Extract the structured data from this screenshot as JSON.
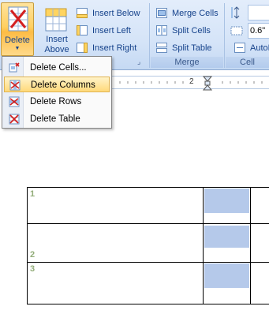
{
  "ribbon": {
    "delete_label": "Delete",
    "insert_above_label_line1": "Insert",
    "insert_above_label_line2": "Above",
    "insert_below_label": "Insert Below",
    "insert_left_label": "Insert Left",
    "insert_right_label": "Insert Right",
    "merge_cells_label": "Merge Cells",
    "split_cells_label": "Split Cells",
    "split_table_label": "Split Table",
    "merge_group_label": "Merge",
    "cell_group_label": "Cell",
    "height_value": "0.6\"",
    "autofit_label": "AutoFit"
  },
  "menu": {
    "items": [
      {
        "label": "Delete Cells...",
        "icon": "delete-cells-icon"
      },
      {
        "label": "Delete Columns",
        "icon": "delete-columns-icon"
      },
      {
        "label": "Delete Rows",
        "icon": "delete-rows-icon"
      },
      {
        "label": "Delete Table",
        "icon": "delete-table-icon"
      }
    ],
    "highlighted_index": 1
  },
  "ruler": {
    "mark": "2"
  },
  "table": {
    "row_labels": [
      "1",
      "2",
      "3"
    ]
  },
  "colors": {
    "ribbon_bg": "#d5e4f8",
    "active_button": "#ffd062",
    "menu_highlight": "#ffd97a",
    "selected_cell": "#b5c9ea",
    "row_number": "#93ad7a"
  }
}
